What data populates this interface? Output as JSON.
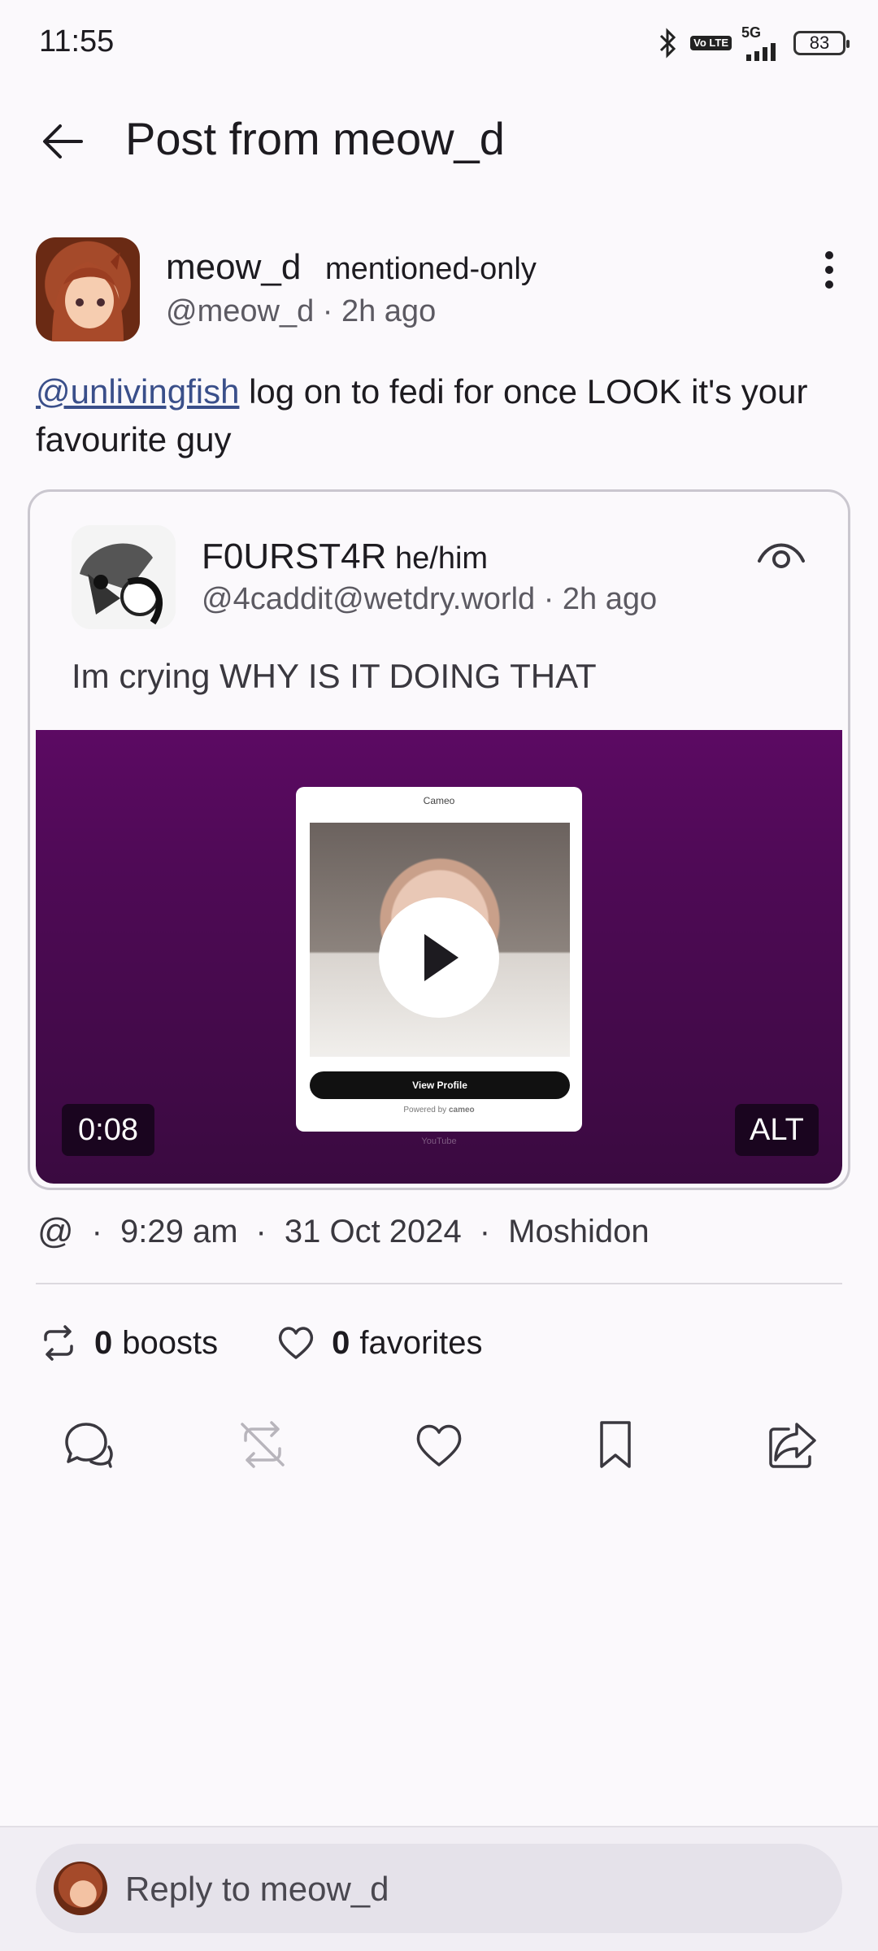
{
  "status_bar": {
    "time": "11:55",
    "network": "5G",
    "volte": "Vo LTE",
    "battery": "83"
  },
  "header": {
    "title": "Post from meow_d"
  },
  "post": {
    "author_name": "meow_d",
    "visibility": "mentioned-only",
    "handle_time": "@meow_d · 2h ago",
    "mention": "@unlivingfish",
    "text": " log on to fedi for once LOOK it's your favourite guy"
  },
  "quote": {
    "author_name": "F0URST4R",
    "pronouns": "he/him",
    "handle_time": "@4caddit@wetdry.world · 2h ago",
    "text": "Im crying WHY IS IT DOING THAT",
    "video": {
      "duration": "0:08",
      "alt_label": "ALT",
      "modal_title": "Cameo",
      "modal_button": "View Profile",
      "modal_powered": "Powered by",
      "modal_brand": "cameo",
      "footer_text": "YouTube"
    }
  },
  "meta": {
    "symbol": "@",
    "time": "9:29 am",
    "date": "31 Oct 2024",
    "client": "Moshidon"
  },
  "stats": {
    "boosts_count": "0",
    "boosts_label": "boosts",
    "favorites_count": "0",
    "favorites_label": "favorites"
  },
  "reply": {
    "placeholder": "Reply to meow_d"
  }
}
